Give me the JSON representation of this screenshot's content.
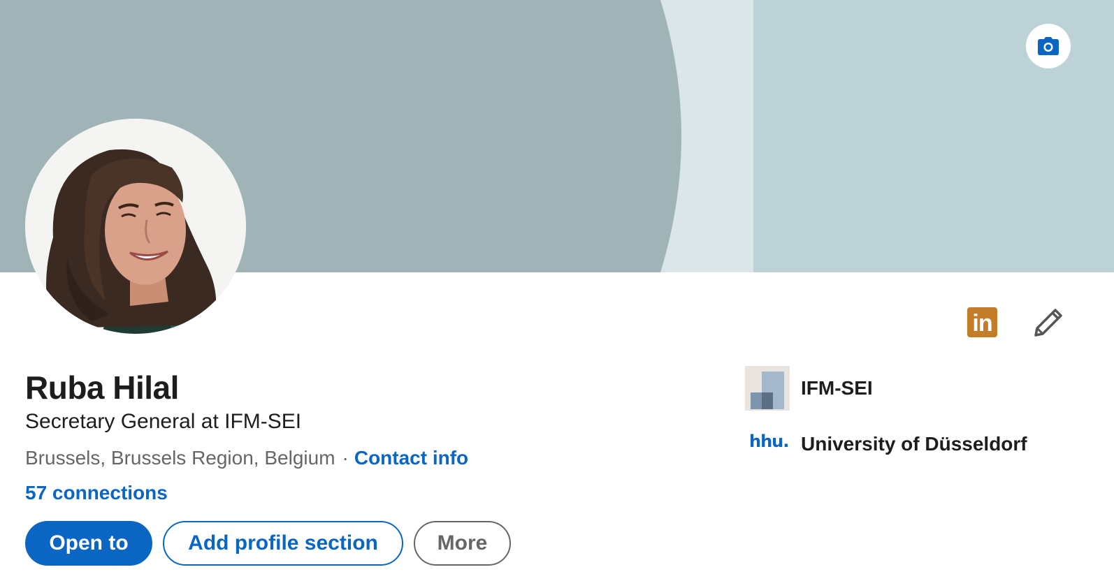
{
  "profile": {
    "name": "Ruba Hilal",
    "headline": "Secretary General at IFM-SEI",
    "location": "Brussels, Brussels Region, Belgium",
    "separator": "·",
    "contact_info_label": "Contact info",
    "connections_label": "57 connections"
  },
  "actions": {
    "open_to_label": "Open to",
    "add_section_label": "Add profile section",
    "more_label": "More"
  },
  "badges": {
    "linkedin_label": "in"
  },
  "organizations": [
    {
      "name": "IFM-SEI"
    },
    {
      "name": "University of Düsseldorf",
      "logo_text": "hhu."
    }
  ],
  "icons": {
    "cover_camera": "camera-icon",
    "edit": "pencil-icon",
    "linkedin": "linkedin-icon"
  },
  "colors": {
    "brand_blue": "#0a66c2",
    "linkedin_badge": "#c37d28",
    "cover_primary": "#a0b4b7",
    "cover_mid": "#dbe6e8",
    "cover_light": "#bdd2d6",
    "text_primary": "#1d1d1d",
    "text_secondary": "#666666"
  }
}
